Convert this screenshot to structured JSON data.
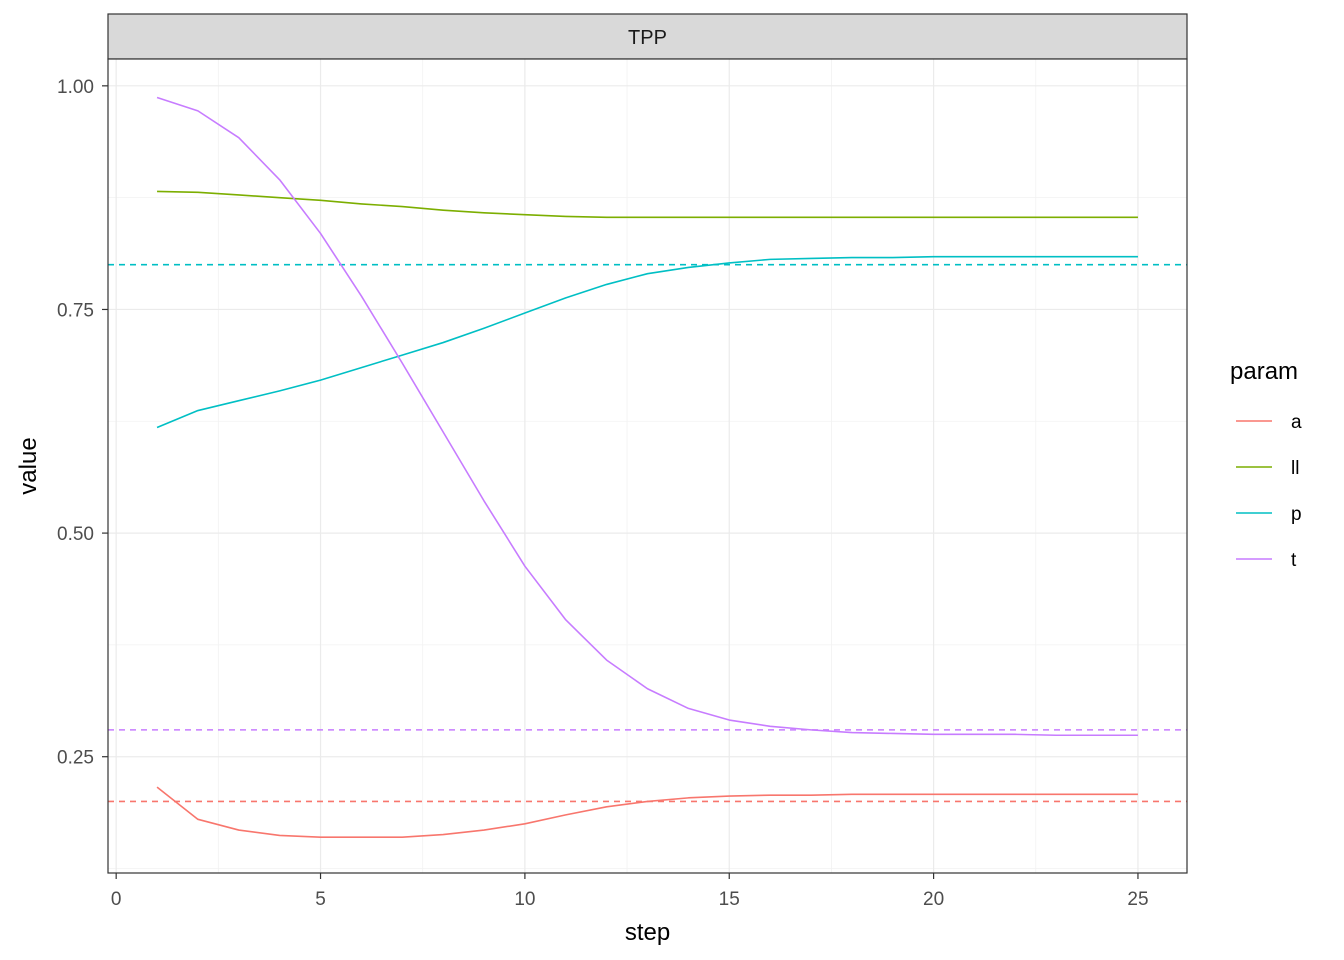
{
  "chart_data": {
    "type": "line",
    "facet_label": "TPP",
    "xlabel": "step",
    "ylabel": "value",
    "xlim": [
      -0.2,
      26.2
    ],
    "ylim": [
      0.12,
      1.03
    ],
    "x_ticks": [
      0,
      5,
      10,
      15,
      20,
      25
    ],
    "x_tick_labels": [
      "0",
      "5",
      "10",
      "15",
      "20",
      "25"
    ],
    "y_ticks": [
      0.25,
      0.5,
      0.75,
      1.0
    ],
    "y_tick_labels": [
      "0.25",
      "0.50",
      "0.75",
      "1.00"
    ],
    "grid": true,
    "legend": {
      "title": "param",
      "position": "right"
    },
    "x": [
      1,
      2,
      3,
      4,
      5,
      6,
      7,
      8,
      9,
      10,
      11,
      12,
      13,
      14,
      15,
      16,
      17,
      18,
      19,
      20,
      21,
      22,
      23,
      24,
      25
    ],
    "series": [
      {
        "name": "a",
        "color": "#F8766D",
        "values": [
          0.216,
          0.18,
          0.168,
          0.162,
          0.16,
          0.16,
          0.16,
          0.163,
          0.168,
          0.175,
          0.185,
          0.194,
          0.2,
          0.204,
          0.206,
          0.207,
          0.207,
          0.208,
          0.208,
          0.208,
          0.208,
          0.208,
          0.208,
          0.208,
          0.208
        ]
      },
      {
        "name": "ll",
        "color": "#7CAE00",
        "values": [
          0.882,
          0.881,
          0.878,
          0.875,
          0.872,
          0.868,
          0.865,
          0.861,
          0.858,
          0.856,
          0.854,
          0.853,
          0.853,
          0.853,
          0.853,
          0.853,
          0.853,
          0.853,
          0.853,
          0.853,
          0.853,
          0.853,
          0.853,
          0.853,
          0.853
        ]
      },
      {
        "name": "p",
        "color": "#00BFC4",
        "values": [
          0.618,
          0.637,
          0.648,
          0.659,
          0.671,
          0.685,
          0.699,
          0.713,
          0.729,
          0.746,
          0.763,
          0.778,
          0.79,
          0.797,
          0.802,
          0.806,
          0.807,
          0.808,
          0.808,
          0.809,
          0.809,
          0.809,
          0.809,
          0.809,
          0.809
        ]
      },
      {
        "name": "t",
        "color": "#C77CFF",
        "values": [
          0.987,
          0.972,
          0.942,
          0.895,
          0.835,
          0.765,
          0.69,
          0.613,
          0.536,
          0.463,
          0.403,
          0.358,
          0.326,
          0.304,
          0.291,
          0.284,
          0.28,
          0.277,
          0.276,
          0.275,
          0.275,
          0.275,
          0.274,
          0.274,
          0.274
        ]
      }
    ],
    "reference_lines": [
      {
        "series": "a",
        "y": 0.2,
        "color": "#F8766D"
      },
      {
        "series": "p",
        "y": 0.8,
        "color": "#00BFC4"
      },
      {
        "series": "t",
        "y": 0.28,
        "color": "#C77CFF"
      }
    ]
  }
}
